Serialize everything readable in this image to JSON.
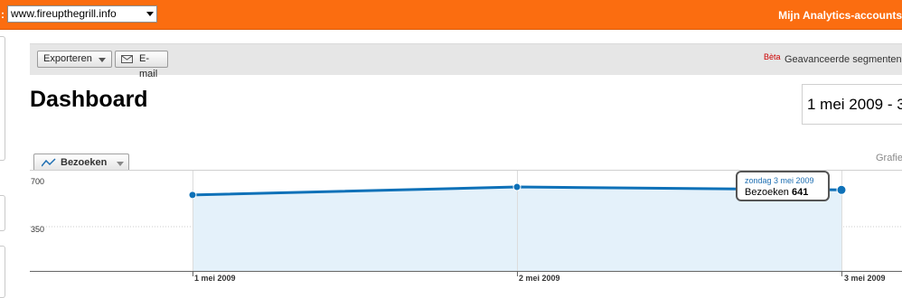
{
  "topbar": {
    "prefix": ":",
    "site_selected": "www.fireupthegrill.info",
    "accounts_link": "Mijn Analytics-accounts"
  },
  "toolbar": {
    "export_label": "Exporteren",
    "email_label": "E-mail",
    "beta_label": "Bèta",
    "advanced_segments_label": "Geavanceerde segmenten:"
  },
  "page": {
    "title": "Dashboard",
    "date_range": "1 mei 2009 - 3"
  },
  "metric_tab": {
    "label": "Bezoeken"
  },
  "graph_label": "Grafiek",
  "tooltip": {
    "date": "zondag 3 mei 2009",
    "metric": "Bezoeken",
    "value": "641"
  },
  "colors": {
    "topbar": "#fb6d10",
    "line": "#0e71b8",
    "area": "#e4f1fa"
  },
  "chart_data": {
    "type": "area",
    "series": [
      {
        "name": "Bezoeken",
        "values": [
          601,
          664,
          641
        ]
      }
    ],
    "categories": [
      "1 mei 2009",
      "2 mei 2009",
      "3 mei 2009"
    ],
    "yticks": [
      "700",
      "350"
    ],
    "ylim": [
      0,
      700
    ],
    "grid": true
  }
}
